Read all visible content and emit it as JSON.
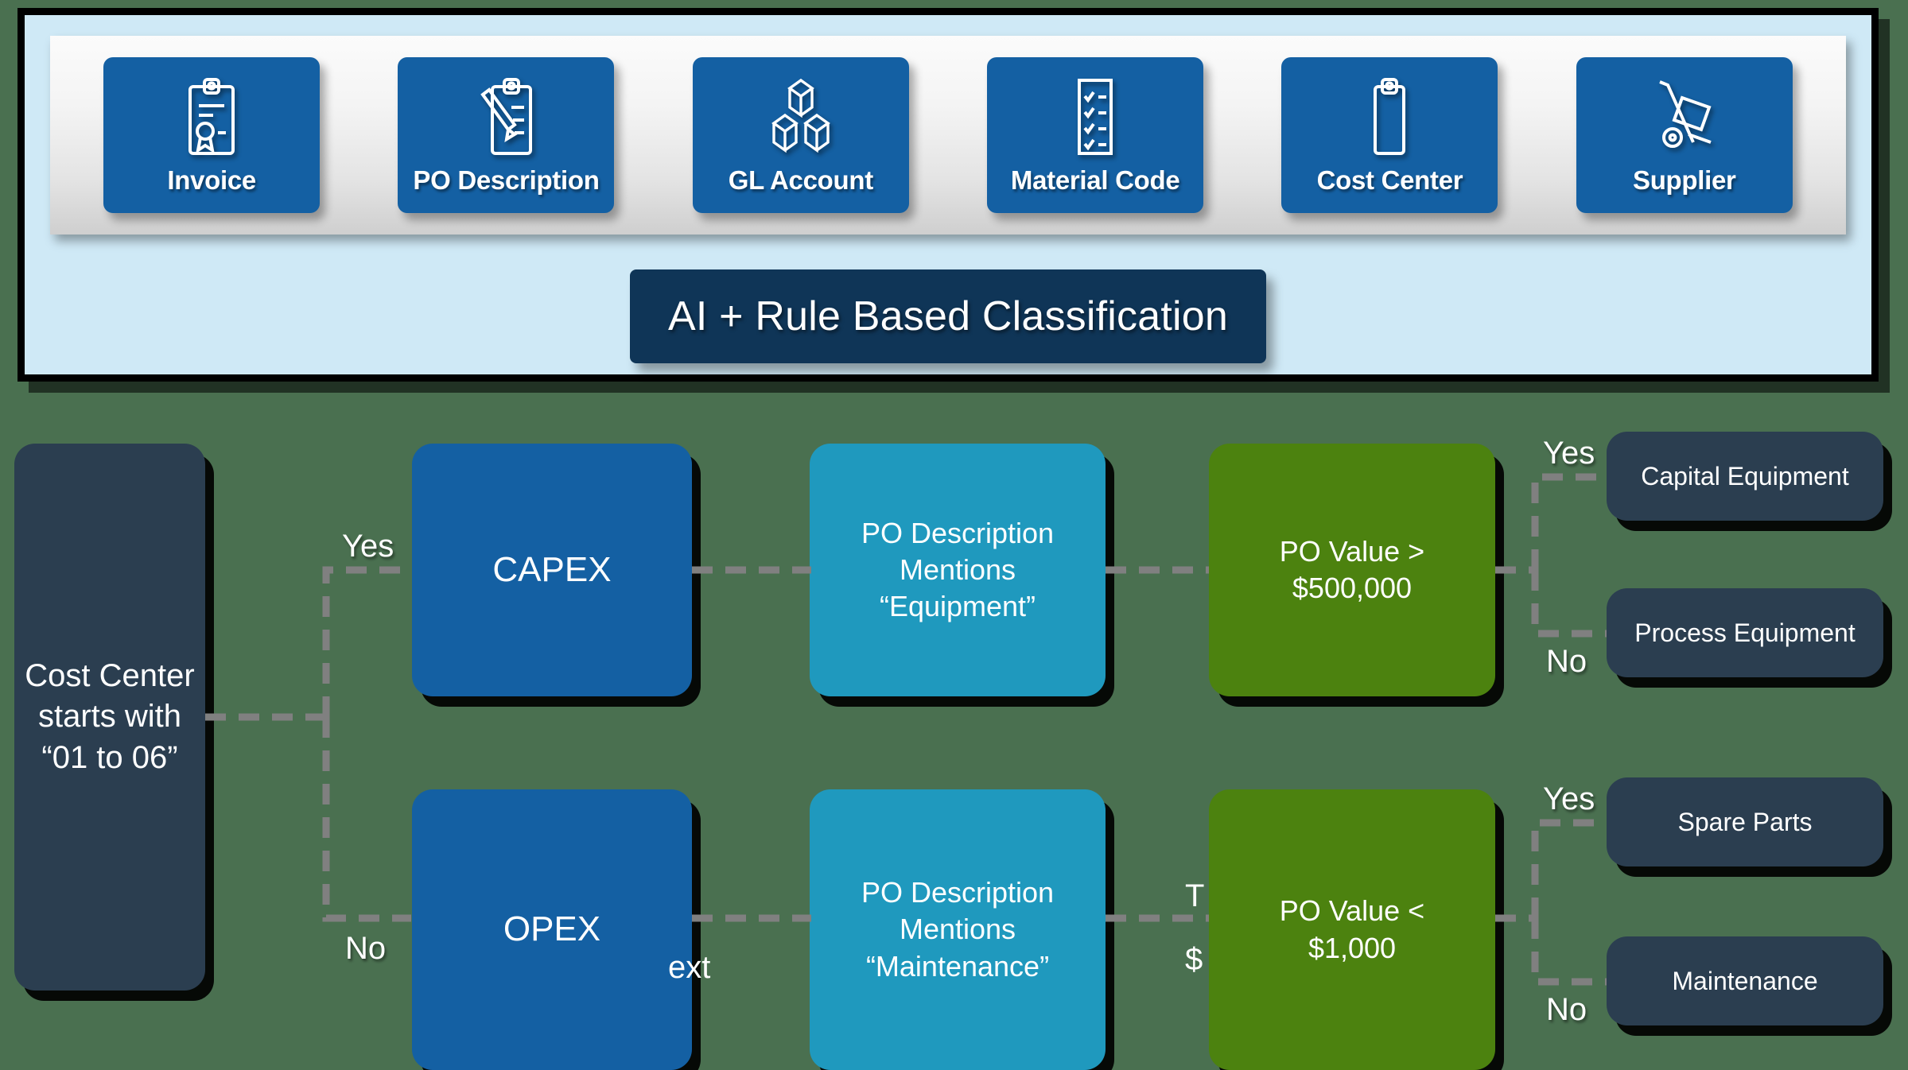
{
  "top_panel": {
    "background_color": "#cfe9f6",
    "cards": [
      {
        "label": "Invoice",
        "icon": "clipboard-certificate-icon"
      },
      {
        "label": "PO Description",
        "icon": "clipboard-pencil-icon"
      },
      {
        "label": "GL Account",
        "icon": "stacked-boxes-icon"
      },
      {
        "label": "Material Code",
        "icon": "checklist-icon"
      },
      {
        "label": "Cost Center",
        "icon": "clipboard-blank-icon"
      },
      {
        "label": "Supplier",
        "icon": "hand-truck-icon"
      }
    ],
    "banner": {
      "label": "AI + Rule Based Classification",
      "color": "#0f3557"
    }
  },
  "flowchart": {
    "colors": {
      "navy": "#2b3e50",
      "blue": "#1460a3",
      "teal": "#1f99be",
      "green": "#4c820f",
      "canvas": "#4a7050",
      "connector": "#808080"
    },
    "nodes": {
      "root": "Cost Center\nstarts with\n“01 to 06”",
      "root_line1": "Cost Center",
      "root_line2": "starts with",
      "root_line3": "“01 to 06”",
      "capex": "CAPEX",
      "opex": "OPEX",
      "capex_desc_line1": "PO Description",
      "capex_desc_line2": "Mentions",
      "capex_desc_line3": "“Equipment”",
      "opex_desc_line1": "PO Description",
      "opex_desc_line2": "Mentions",
      "opex_desc_line3": "“Maintenance”",
      "capex_value_line1": "PO Value >",
      "capex_value_line2": "$500,000",
      "opex_value_line1": "PO Value <",
      "opex_value_line2": "$1,000",
      "out_capital_equipment": "Capital Equipment",
      "out_process_equipment": "Process Equipment",
      "out_spare_parts": "Spare Parts",
      "out_maintenance": "Maintenance"
    },
    "edge_labels": {
      "root_yes": "Yes",
      "root_no": "No",
      "capex_yes": "Yes",
      "capex_no": "No",
      "opex_yes": "Yes",
      "opex_no": "No"
    },
    "occluded_fragments": {
      "opex_link": "ext",
      "opex_value_top": "T",
      "opex_value_bottom": "$"
    }
  }
}
